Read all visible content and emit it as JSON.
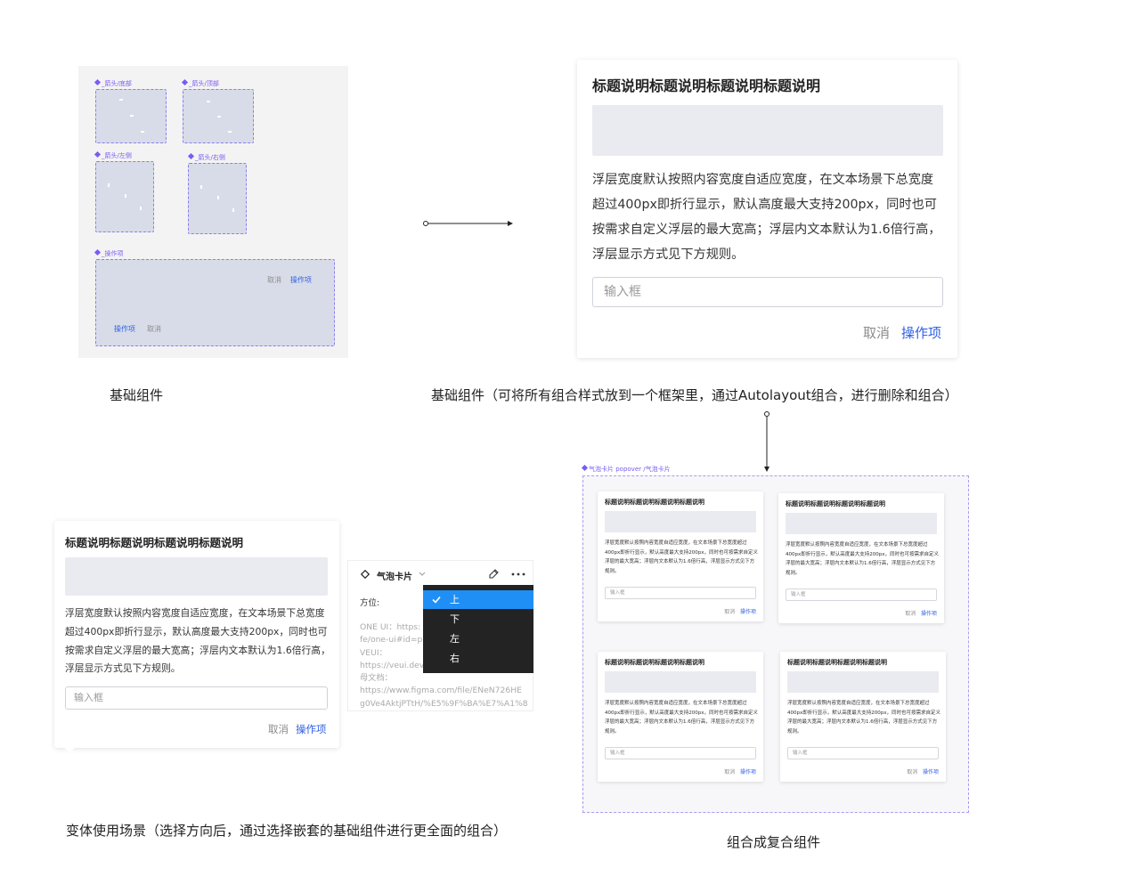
{
  "base_panel": {
    "arrow_bottom_label": "_箭头/底部",
    "arrow_top_label": "_箭头/顶部",
    "arrow_left_label": "_箭头/左侧",
    "arrow_right_label": "_箭头/右侧",
    "actions_label": "_操作项",
    "cancel": "取消",
    "action": "操作项"
  },
  "captions": {
    "base": "基础组件",
    "base_note": "基础组件（可将所有组合样式放到一个框架里，通过Autolayout组合，进行删除和组合）",
    "variant": "变体使用场景（选择方向后，通过选择嵌套的基础组件进行更全面的组合）",
    "composite": "组合成复合组件"
  },
  "popover": {
    "title": "标题说明标题说明标题说明标题说明",
    "body": "浮层宽度默认按照内容宽度自适应宽度，在文本场景下总宽度超过400px即折行显示，默认高度最大支持200px，同时也可按需求自定义浮层的最大宽高；浮层内文本默认为1.6倍行高，浮层显示方式见下方规则。",
    "input_placeholder": "输入框",
    "cancel": "取消",
    "action": "操作项"
  },
  "prop_panel": {
    "component_name": "气泡卡片",
    "direction_label": "方位:",
    "doc_lines": [
      "ONE UI：https:",
      "fe/one-ui#id=p",
      "VEUI：",
      "https://veui.dev",
      "母文档：",
      "https://www.figma.com/file/ENeN726HE",
      "g0Ve4AktjPTtH/%E5%9F%BA%E7%A1%8"
    ],
    "direction_options": [
      "上",
      "下",
      "左",
      "右"
    ],
    "selected_direction": "上"
  },
  "composite": {
    "frame_label": "气泡卡片 popover /气泡卡片"
  },
  "colors": {
    "accent": "#3061e5",
    "purple": "#7a5cf0",
    "menu_active": "#1f8ff5"
  }
}
